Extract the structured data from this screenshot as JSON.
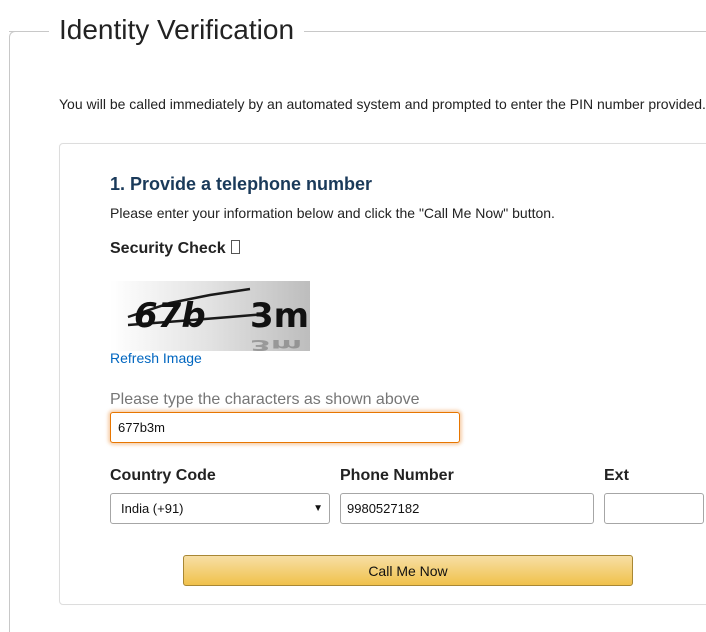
{
  "page": {
    "title": "Identity Verification",
    "intro": "You will be called immediately by an automated system and prompted to enter the PIN number provided."
  },
  "step": {
    "title": "1. Provide a telephone number",
    "description": "Please enter your information below and click the \"Call Me Now\" button."
  },
  "security": {
    "label": "Security Check",
    "info_icon": "info-icon",
    "captcha_text": "677b3m",
    "refresh_label": "Refresh Image",
    "prompt": "Please type the characters as shown above",
    "input_value": "677b3m"
  },
  "form": {
    "country_label": "Country Code",
    "country_value": "India (+91)",
    "phone_label": "Phone Number",
    "phone_value": "9980527182",
    "ext_label": "Ext",
    "ext_value": ""
  },
  "actions": {
    "call_label": "Call Me Now"
  },
  "colors": {
    "link": "#0066c0",
    "heading": "#1a3a5a",
    "focus": "#e77600",
    "button": "#f0c14b"
  }
}
